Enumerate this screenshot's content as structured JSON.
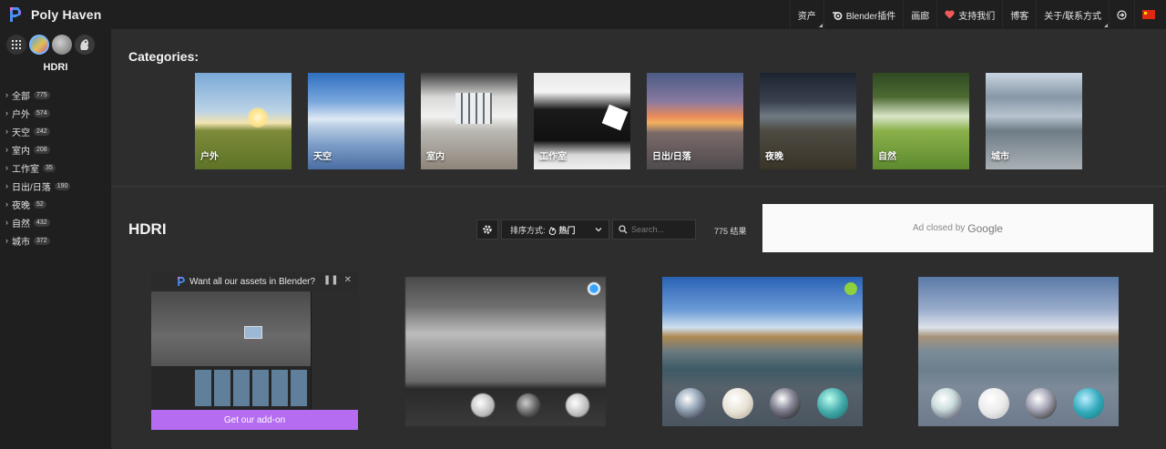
{
  "header": {
    "brand_name": "Poly Haven",
    "nav": [
      {
        "label": "资产",
        "icon": null,
        "caret": true
      },
      {
        "label": "Blender插件",
        "icon": "blender-icon",
        "caret": false
      },
      {
        "label": "画廊",
        "icon": null,
        "caret": false
      },
      {
        "label": "支持我们",
        "icon": "heart-icon",
        "caret": false
      },
      {
        "label": "博客",
        "icon": null,
        "caret": false
      },
      {
        "label": "关于/联系方式",
        "icon": null,
        "caret": true
      }
    ],
    "login_icon": "login-icon",
    "language_flag": "cn-flag-icon"
  },
  "sidebar": {
    "type_icons": [
      "grid-icon",
      "hdri-icon",
      "texture-icon",
      "model-icon"
    ],
    "title": "HDRI",
    "categories": [
      {
        "label": "全部",
        "count": "775"
      },
      {
        "label": "户外",
        "count": "574"
      },
      {
        "label": "天空",
        "count": "242"
      },
      {
        "label": "室内",
        "count": "208"
      },
      {
        "label": "工作室",
        "count": "35"
      },
      {
        "label": "日出/日落",
        "count": "190"
      },
      {
        "label": "夜晚",
        "count": "52"
      },
      {
        "label": "自然",
        "count": "432"
      },
      {
        "label": "城市",
        "count": "372"
      }
    ]
  },
  "main": {
    "categories_heading": "Categories:",
    "category_cards": [
      {
        "label": "户外"
      },
      {
        "label": "天空"
      },
      {
        "label": "室内"
      },
      {
        "label": "工作室"
      },
      {
        "label": "日出/日落"
      },
      {
        "label": "夜晚"
      },
      {
        "label": "自然"
      },
      {
        "label": "城市"
      }
    ],
    "section_title": "HDRI",
    "sort_label": "排序方式:",
    "sort_value": "热门",
    "search_placeholder": "Search...",
    "results_text": "775 结果",
    "ad_text": "Ad closed by",
    "ad_brand": "Google",
    "promo": {
      "title": "Want all our assets in Blender?",
      "button": "Get our add-on",
      "pause": "❚❚",
      "close": "✕"
    },
    "badge_colors": {
      "blue": "#3aa2ff",
      "green": "#8dd13e"
    }
  }
}
